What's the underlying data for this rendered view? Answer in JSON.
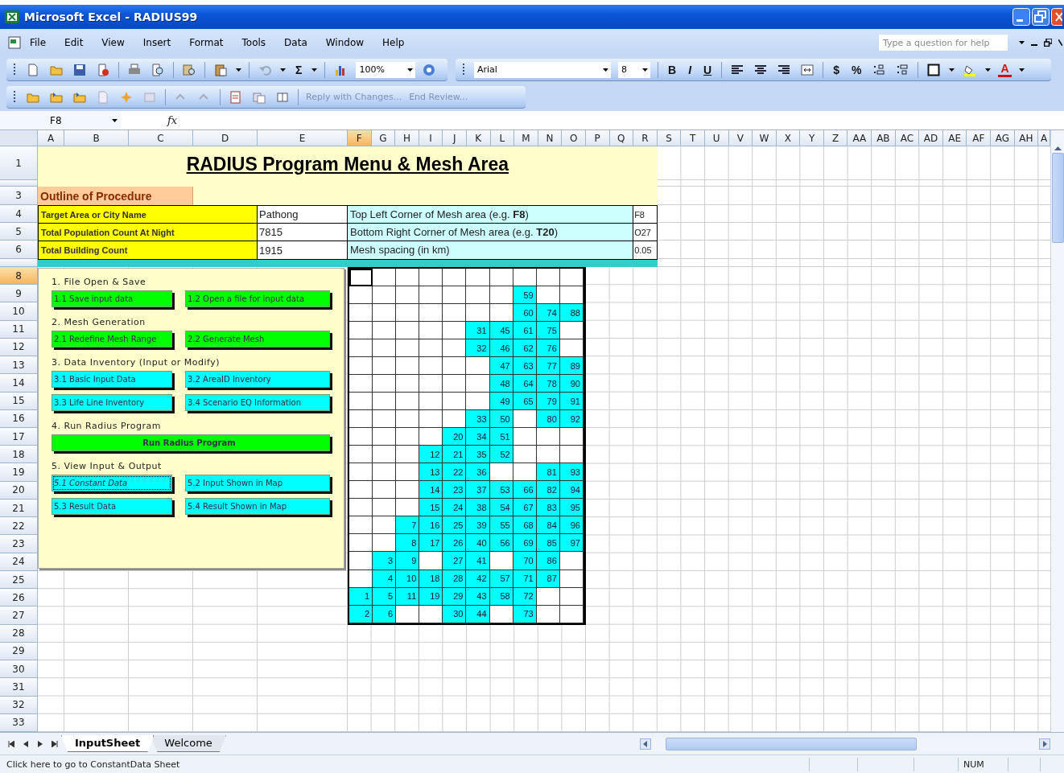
{
  "window": {
    "title": "Microsoft Excel - RADIUS99"
  },
  "menu": [
    "File",
    "Edit",
    "View",
    "Insert",
    "Format",
    "Tools",
    "Data",
    "Window",
    "Help"
  ],
  "help_box": {
    "placeholder": "Type a question for help"
  },
  "standard_toolbar": {
    "sum": "Σ",
    "zoom": "100%"
  },
  "formatting_toolbar": {
    "font": "Arial",
    "size": "8",
    "bold": "B",
    "italic": "I",
    "underline": "U",
    "currency": "$",
    "percent": "%",
    "font_color": "A"
  },
  "reviewing_toolbar": [
    {
      "label": "Reply with Changes...",
      "disabled": true
    },
    {
      "label": "End Review...",
      "disabled": true
    }
  ],
  "formula_bar": {
    "name_box": "F8",
    "fx": "fx"
  },
  "columns": [
    {
      "label": "A",
      "selected": false
    },
    {
      "label": "B",
      "selected": false
    },
    {
      "label": "C",
      "selected": false
    },
    {
      "label": "D",
      "selected": false
    },
    {
      "label": "E",
      "selected": false
    },
    {
      "label": "F",
      "selected": true
    },
    {
      "label": "G",
      "selected": false
    },
    {
      "label": "H",
      "selected": false
    },
    {
      "label": "I",
      "selected": false
    },
    {
      "label": "J",
      "selected": false
    },
    {
      "label": "K",
      "selected": false
    },
    {
      "label": "L",
      "selected": false
    },
    {
      "label": "M",
      "selected": false
    },
    {
      "label": "N",
      "selected": false
    },
    {
      "label": "O",
      "selected": false
    },
    {
      "label": "P",
      "selected": false
    },
    {
      "label": "Q",
      "selected": false
    },
    {
      "label": "R",
      "selected": false
    },
    {
      "label": "S",
      "selected": false
    },
    {
      "label": "T",
      "selected": false
    },
    {
      "label": "U",
      "selected": false
    },
    {
      "label": "V",
      "selected": false
    },
    {
      "label": "W",
      "selected": false
    },
    {
      "label": "X",
      "selected": false
    },
    {
      "label": "Y",
      "selected": false
    },
    {
      "label": "Z",
      "selected": false
    },
    {
      "label": "AA",
      "selected": false
    },
    {
      "label": "AB",
      "selected": false
    },
    {
      "label": "AC",
      "selected": false
    },
    {
      "label": "AD",
      "selected": false
    },
    {
      "label": "AE",
      "selected": false
    },
    {
      "label": "AF",
      "selected": false
    },
    {
      "label": "AG",
      "selected": false
    },
    {
      "label": "AH",
      "selected": false
    },
    {
      "label": "A",
      "selected": false
    }
  ],
  "rows": [
    {
      "label": "1",
      "selected": false
    },
    {
      "label": "3",
      "selected": false
    },
    {
      "label": "4",
      "selected": false
    },
    {
      "label": "5",
      "selected": false
    },
    {
      "label": "6",
      "selected": false
    },
    {
      "label": "8",
      "selected": true
    },
    {
      "label": "9",
      "selected": false
    },
    {
      "label": "10",
      "selected": false
    },
    {
      "label": "11",
      "selected": false
    },
    {
      "label": "12",
      "selected": false
    },
    {
      "label": "13",
      "selected": false
    },
    {
      "label": "14",
      "selected": false
    },
    {
      "label": "15",
      "selected": false
    },
    {
      "label": "16",
      "selected": false
    },
    {
      "label": "17",
      "selected": false
    },
    {
      "label": "18",
      "selected": false
    },
    {
      "label": "19",
      "selected": false
    },
    {
      "label": "20",
      "selected": false
    },
    {
      "label": "21",
      "selected": false
    },
    {
      "label": "22",
      "selected": false
    },
    {
      "label": "23",
      "selected": false
    },
    {
      "label": "24",
      "selected": false
    },
    {
      "label": "25",
      "selected": false
    },
    {
      "label": "26",
      "selected": false
    },
    {
      "label": "27",
      "selected": false
    },
    {
      "label": "28",
      "selected": false
    },
    {
      "label": "29",
      "selected": false
    },
    {
      "label": "30",
      "selected": false
    },
    {
      "label": "31",
      "selected": false
    },
    {
      "label": "32",
      "selected": false
    },
    {
      "label": "33",
      "selected": false
    }
  ],
  "sheet_title": "RADIUS Program Menu & Mesh Area",
  "outline": "Outline of Procedure",
  "inputs": [
    {
      "label": "Target Area or City Name",
      "value": "Pathong"
    },
    {
      "label": "Total Population Count At Night",
      "value": "7815"
    },
    {
      "label": "Total Building Count",
      "value": "1915"
    }
  ],
  "mesh_settings": [
    {
      "label": "Top Left Corner of Mesh area (e.g. **F8**)",
      "value": "F8"
    },
    {
      "label": "Bottom Right Corner of Mesh area (e.g. **T20**)",
      "value": "O27"
    },
    {
      "label": "Mesh spacing (in km)",
      "value": "0.05"
    }
  ],
  "menu_panel": [
    {
      "heading": "1. File Open & Save",
      "buttons": [
        {
          "label": "1.1 Save input data",
          "kind": "half",
          "color": "#00ff00",
          "focused": false
        },
        {
          "label": "1.2 Open a file for input data",
          "kind": "half",
          "color": "#00ff00",
          "focused": false
        }
      ]
    },
    {
      "heading": "2. Mesh Generation",
      "buttons": [
        {
          "label": "2.1 Redefine Mesh Range",
          "kind": "half",
          "color": "#00ff00",
          "focused": false
        },
        {
          "label": "2.2 Generate Mesh",
          "kind": "half",
          "color": "#00ff00",
          "focused": false
        }
      ]
    },
    {
      "heading": "3. Data Inventory (Input or Modify)",
      "buttons": [
        {
          "label": "3.1 Basic Input Data",
          "kind": "half",
          "color": "#00ffff",
          "focused": false
        },
        {
          "label": "3.2 AreaID Inventory",
          "kind": "half",
          "color": "#00ffff",
          "focused": false
        },
        {
          "label": "3.3 Life Line Inventory",
          "kind": "half",
          "color": "#00ffff",
          "focused": false
        },
        {
          "label": "3.4 Scenario EQ Information",
          "kind": "half",
          "color": "#00ffff",
          "focused": false
        }
      ]
    },
    {
      "heading": "4. Run Radius Program",
      "buttons": [
        {
          "label": "Run Radius Program",
          "kind": "wide",
          "color": "#00ff00",
          "focused": false
        }
      ]
    },
    {
      "heading": "5. View Input & Output",
      "buttons": [
        {
          "label": "5.1 Constant Data",
          "kind": "half",
          "color": "#00ffff",
          "focused": true
        },
        {
          "label": "5.2 Input Shown in Map",
          "kind": "half",
          "color": "#00ffff",
          "focused": false
        },
        {
          "label": "5.3 Result Data",
          "kind": "half",
          "color": "#00ffff",
          "focused": false
        },
        {
          "label": "5.4 Result Shown in Map",
          "kind": "half",
          "color": "#00ffff",
          "focused": false
        }
      ]
    }
  ],
  "mesh": [
    [
      {
        "filled": false,
        "selected": true
      },
      {
        "filled": false,
        "selected": false
      },
      {
        "filled": false,
        "selected": false
      },
      {
        "filled": false,
        "selected": false
      },
      {
        "filled": false,
        "selected": false
      },
      {
        "filled": false,
        "selected": false
      },
      {
        "filled": false,
        "selected": false
      },
      {
        "filled": false,
        "selected": false
      },
      {
        "filled": false,
        "selected": false
      },
      {
        "filled": false,
        "selected": false
      }
    ],
    [
      {
        "filled": false,
        "selected": false
      },
      {
        "filled": false,
        "selected": false
      },
      {
        "filled": false,
        "selected": false
      },
      {
        "filled": false,
        "selected": false
      },
      {
        "filled": false,
        "selected": false
      },
      {
        "filled": false,
        "selected": false
      },
      {
        "filled": false,
        "selected": false
      },
      {
        "filled": true,
        "selected": false,
        "value": "59"
      },
      {
        "filled": false,
        "selected": false
      },
      {
        "filled": false,
        "selected": false
      }
    ],
    [
      {
        "filled": false,
        "selected": false
      },
      {
        "filled": false,
        "selected": false
      },
      {
        "filled": false,
        "selected": false
      },
      {
        "filled": false,
        "selected": false
      },
      {
        "filled": false,
        "selected": false
      },
      {
        "filled": false,
        "selected": false
      },
      {
        "filled": false,
        "selected": false
      },
      {
        "filled": true,
        "selected": false,
        "value": "60"
      },
      {
        "filled": true,
        "selected": false,
        "value": "74"
      },
      {
        "filled": true,
        "selected": false,
        "value": "88"
      }
    ],
    [
      {
        "filled": false,
        "selected": false
      },
      {
        "filled": false,
        "selected": false
      },
      {
        "filled": false,
        "selected": false
      },
      {
        "filled": false,
        "selected": false
      },
      {
        "filled": false,
        "selected": false
      },
      {
        "filled": true,
        "selected": false,
        "value": "31"
      },
      {
        "filled": true,
        "selected": false,
        "value": "45"
      },
      {
        "filled": true,
        "selected": false,
        "value": "61"
      },
      {
        "filled": true,
        "selected": false,
        "value": "75"
      },
      {
        "filled": false,
        "selected": false
      }
    ],
    [
      {
        "filled": false,
        "selected": false
      },
      {
        "filled": false,
        "selected": false
      },
      {
        "filled": false,
        "selected": false
      },
      {
        "filled": false,
        "selected": false
      },
      {
        "filled": false,
        "selected": false
      },
      {
        "filled": true,
        "selected": false,
        "value": "32"
      },
      {
        "filled": true,
        "selected": false,
        "value": "46"
      },
      {
        "filled": true,
        "selected": false,
        "value": "62"
      },
      {
        "filled": true,
        "selected": false,
        "value": "76"
      },
      {
        "filled": false,
        "selected": false
      }
    ],
    [
      {
        "filled": false,
        "selected": false
      },
      {
        "filled": false,
        "selected": false
      },
      {
        "filled": false,
        "selected": false
      },
      {
        "filled": false,
        "selected": false
      },
      {
        "filled": false,
        "selected": false
      },
      {
        "filled": false,
        "selected": false
      },
      {
        "filled": true,
        "selected": false,
        "value": "47"
      },
      {
        "filled": true,
        "selected": false,
        "value": "63"
      },
      {
        "filled": true,
        "selected": false,
        "value": "77"
      },
      {
        "filled": true,
        "selected": false,
        "value": "89"
      }
    ],
    [
      {
        "filled": false,
        "selected": false
      },
      {
        "filled": false,
        "selected": false
      },
      {
        "filled": false,
        "selected": false
      },
      {
        "filled": false,
        "selected": false
      },
      {
        "filled": false,
        "selected": false
      },
      {
        "filled": false,
        "selected": false
      },
      {
        "filled": true,
        "selected": false,
        "value": "48"
      },
      {
        "filled": true,
        "selected": false,
        "value": "64"
      },
      {
        "filled": true,
        "selected": false,
        "value": "78"
      },
      {
        "filled": true,
        "selected": false,
        "value": "90"
      }
    ],
    [
      {
        "filled": false,
        "selected": false
      },
      {
        "filled": false,
        "selected": false
      },
      {
        "filled": false,
        "selected": false
      },
      {
        "filled": false,
        "selected": false
      },
      {
        "filled": false,
        "selected": false
      },
      {
        "filled": false,
        "selected": false
      },
      {
        "filled": true,
        "selected": false,
        "value": "49"
      },
      {
        "filled": true,
        "selected": false,
        "value": "65"
      },
      {
        "filled": true,
        "selected": false,
        "value": "79"
      },
      {
        "filled": true,
        "selected": false,
        "value": "91"
      }
    ],
    [
      {
        "filled": false,
        "selected": false
      },
      {
        "filled": false,
        "selected": false
      },
      {
        "filled": false,
        "selected": false
      },
      {
        "filled": false,
        "selected": false
      },
      {
        "filled": false,
        "selected": false
      },
      {
        "filled": true,
        "selected": false,
        "value": "33"
      },
      {
        "filled": true,
        "selected": false,
        "value": "50"
      },
      {
        "filled": false,
        "selected": false
      },
      {
        "filled": true,
        "selected": false,
        "value": "80"
      },
      {
        "filled": true,
        "selected": false,
        "value": "92"
      }
    ],
    [
      {
        "filled": false,
        "selected": false
      },
      {
        "filled": false,
        "selected": false
      },
      {
        "filled": false,
        "selected": false
      },
      {
        "filled": false,
        "selected": false
      },
      {
        "filled": true,
        "selected": false,
        "value": "20"
      },
      {
        "filled": true,
        "selected": false,
        "value": "34"
      },
      {
        "filled": true,
        "selected": false,
        "value": "51"
      },
      {
        "filled": false,
        "selected": false
      },
      {
        "filled": false,
        "selected": false
      },
      {
        "filled": false,
        "selected": false
      }
    ],
    [
      {
        "filled": false,
        "selected": false
      },
      {
        "filled": false,
        "selected": false
      },
      {
        "filled": false,
        "selected": false
      },
      {
        "filled": true,
        "selected": false,
        "value": "12"
      },
      {
        "filled": true,
        "selected": false,
        "value": "21"
      },
      {
        "filled": true,
        "selected": false,
        "value": "35"
      },
      {
        "filled": true,
        "selected": false,
        "value": "52"
      },
      {
        "filled": false,
        "selected": false
      },
      {
        "filled": false,
        "selected": false
      },
      {
        "filled": false,
        "selected": false
      }
    ],
    [
      {
        "filled": false,
        "selected": false
      },
      {
        "filled": false,
        "selected": false
      },
      {
        "filled": false,
        "selected": false
      },
      {
        "filled": true,
        "selected": false,
        "value": "13"
      },
      {
        "filled": true,
        "selected": false,
        "value": "22"
      },
      {
        "filled": true,
        "selected": false,
        "value": "36"
      },
      {
        "filled": false,
        "selected": false
      },
      {
        "filled": false,
        "selected": false
      },
      {
        "filled": true,
        "selected": false,
        "value": "81"
      },
      {
        "filled": true,
        "selected": false,
        "value": "93"
      }
    ],
    [
      {
        "filled": false,
        "selected": false
      },
      {
        "filled": false,
        "selected": false
      },
      {
        "filled": false,
        "selected": false
      },
      {
        "filled": true,
        "selected": false,
        "value": "14"
      },
      {
        "filled": true,
        "selected": false,
        "value": "23"
      },
      {
        "filled": true,
        "selected": false,
        "value": "37"
      },
      {
        "filled": true,
        "selected": false,
        "value": "53"
      },
      {
        "filled": true,
        "selected": false,
        "value": "66"
      },
      {
        "filled": true,
        "selected": false,
        "value": "82"
      },
      {
        "filled": true,
        "selected": false,
        "value": "94"
      }
    ],
    [
      {
        "filled": false,
        "selected": false
      },
      {
        "filled": false,
        "selected": false
      },
      {
        "filled": false,
        "selected": false
      },
      {
        "filled": true,
        "selected": false,
        "value": "15"
      },
      {
        "filled": true,
        "selected": false,
        "value": "24"
      },
      {
        "filled": true,
        "selected": false,
        "value": "38"
      },
      {
        "filled": true,
        "selected": false,
        "value": "54"
      },
      {
        "filled": true,
        "selected": false,
        "value": "67"
      },
      {
        "filled": true,
        "selected": false,
        "value": "83"
      },
      {
        "filled": true,
        "selected": false,
        "value": "95"
      }
    ],
    [
      {
        "filled": false,
        "selected": false
      },
      {
        "filled": false,
        "selected": false
      },
      {
        "filled": true,
        "selected": false,
        "value": "7"
      },
      {
        "filled": true,
        "selected": false,
        "value": "16"
      },
      {
        "filled": true,
        "selected": false,
        "value": "25"
      },
      {
        "filled": true,
        "selected": false,
        "value": "39"
      },
      {
        "filled": true,
        "selected": false,
        "value": "55"
      },
      {
        "filled": true,
        "selected": false,
        "value": "68"
      },
      {
        "filled": true,
        "selected": false,
        "value": "84"
      },
      {
        "filled": true,
        "selected": false,
        "value": "96"
      }
    ],
    [
      {
        "filled": false,
        "selected": false
      },
      {
        "filled": false,
        "selected": false
      },
      {
        "filled": true,
        "selected": false,
        "value": "8"
      },
      {
        "filled": true,
        "selected": false,
        "value": "17"
      },
      {
        "filled": true,
        "selected": false,
        "value": "26"
      },
      {
        "filled": true,
        "selected": false,
        "value": "40"
      },
      {
        "filled": true,
        "selected": false,
        "value": "56"
      },
      {
        "filled": true,
        "selected": false,
        "value": "69"
      },
      {
        "filled": true,
        "selected": false,
        "value": "85"
      },
      {
        "filled": true,
        "selected": false,
        "value": "97"
      }
    ],
    [
      {
        "filled": false,
        "selected": false
      },
      {
        "filled": true,
        "selected": false,
        "value": "3"
      },
      {
        "filled": true,
        "selected": false,
        "value": "9"
      },
      {
        "filled": false,
        "selected": false
      },
      {
        "filled": true,
        "selected": false,
        "value": "27"
      },
      {
        "filled": true,
        "selected": false,
        "value": "41"
      },
      {
        "filled": false,
        "selected": false
      },
      {
        "filled": true,
        "selected": false,
        "value": "70"
      },
      {
        "filled": true,
        "selected": false,
        "value": "86"
      },
      {
        "filled": false,
        "selected": false
      }
    ],
    [
      {
        "filled": false,
        "selected": false
      },
      {
        "filled": true,
        "selected": false,
        "value": "4"
      },
      {
        "filled": true,
        "selected": false,
        "value": "10"
      },
      {
        "filled": true,
        "selected": false,
        "value": "18"
      },
      {
        "filled": true,
        "selected": false,
        "value": "28"
      },
      {
        "filled": true,
        "selected": false,
        "value": "42"
      },
      {
        "filled": true,
        "selected": false,
        "value": "57"
      },
      {
        "filled": true,
        "selected": false,
        "value": "71"
      },
      {
        "filled": true,
        "selected": false,
        "value": "87"
      },
      {
        "filled": false,
        "selected": false
      }
    ],
    [
      {
        "filled": true,
        "selected": false,
        "value": "1"
      },
      {
        "filled": true,
        "selected": false,
        "value": "5"
      },
      {
        "filled": true,
        "selected": false,
        "value": "11"
      },
      {
        "filled": true,
        "selected": false,
        "value": "19"
      },
      {
        "filled": true,
        "selected": false,
        "value": "29"
      },
      {
        "filled": true,
        "selected": false,
        "value": "43"
      },
      {
        "filled": true,
        "selected": false,
        "value": "58"
      },
      {
        "filled": true,
        "selected": false,
        "value": "72"
      },
      {
        "filled": false,
        "selected": false
      },
      {
        "filled": false,
        "selected": false
      }
    ],
    [
      {
        "filled": true,
        "selected": false,
        "value": "2"
      },
      {
        "filled": true,
        "selected": false,
        "value": "6"
      },
      {
        "filled": false,
        "selected": false
      },
      {
        "filled": false,
        "selected": false
      },
      {
        "filled": true,
        "selected": false,
        "value": "30"
      },
      {
        "filled": true,
        "selected": false,
        "value": "44"
      },
      {
        "filled": false,
        "selected": false
      },
      {
        "filled": true,
        "selected": false,
        "value": "73"
      },
      {
        "filled": false,
        "selected": false
      },
      {
        "filled": false,
        "selected": false
      }
    ]
  ],
  "sheet_tabs": [
    {
      "label": "InputSheet",
      "selected": true
    },
    {
      "label": "Welcome",
      "selected": false
    }
  ],
  "status_bar": {
    "message": "Click here to go to ConstantData Sheet",
    "num": "NUM"
  }
}
